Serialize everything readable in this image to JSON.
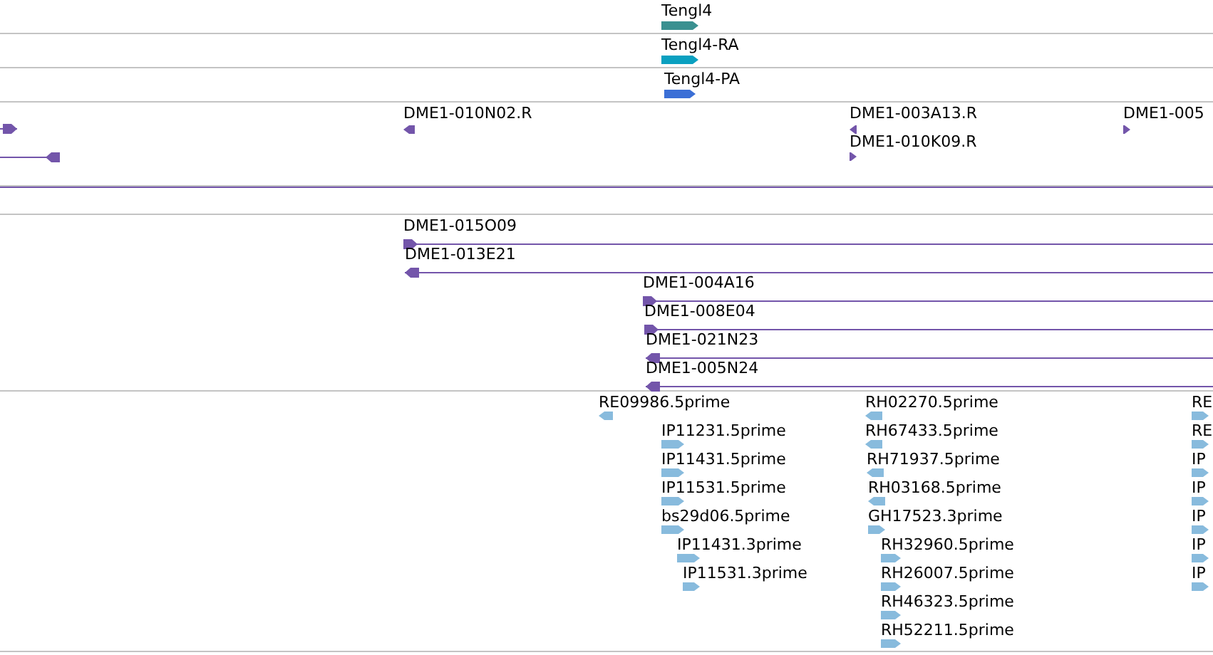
{
  "tracks": [
    {
      "color": "#3a9090",
      "features": [
        {
          "label": "Tengl4",
          "reverse": false
        }
      ]
    },
    {
      "color": "#0aa0c0",
      "features": [
        {
          "label": "Tengl4-RA",
          "reverse": false
        }
      ]
    },
    {
      "color": "#3b6fd6",
      "features": [
        {
          "label": "Tengl4-PA",
          "reverse": false
        }
      ]
    },
    {
      "color": "#7355aa",
      "features": [
        {
          "reverse": false
        },
        {
          "reverse": true
        },
        {
          "label": "DME1-010N02.R",
          "reverse": true
        },
        {
          "label": "DME1-003A13.R",
          "reverse": true
        },
        {
          "label": "DME1-010K09.R",
          "reverse": false
        },
        {
          "label": "DME1-005",
          "reverse": false
        }
      ]
    },
    {
      "color": "#7355aa"
    },
    {
      "color": "#7355aa",
      "features": [
        {
          "label": "DME1-015O09",
          "reverse": false
        },
        {
          "label": "DME1-013E21",
          "reverse": true
        },
        {
          "label": "DME1-004A16",
          "reverse": false
        },
        {
          "label": "DME1-008E04",
          "reverse": false
        },
        {
          "label": "DME1-021N23",
          "reverse": true
        },
        {
          "label": "DME1-005N24",
          "reverse": true
        }
      ]
    },
    {
      "color": "#88bbdd",
      "features": [
        {
          "label": "RE09986.5prime",
          "reverse": true
        },
        {
          "label": "IP11231.5prime",
          "reverse": false
        },
        {
          "label": "IP11431.5prime",
          "reverse": false
        },
        {
          "label": "IP11531.5prime",
          "reverse": false
        },
        {
          "label": "bs29d06.5prime",
          "reverse": false
        },
        {
          "label": "IP11431.3prime",
          "reverse": false
        },
        {
          "label": "IP11531.3prime",
          "reverse": false
        },
        {
          "label": "RH02270.5prime",
          "reverse": true
        },
        {
          "label": "RH67433.5prime",
          "reverse": true
        },
        {
          "label": "RH71937.5prime",
          "reverse": true
        },
        {
          "label": "RH03168.5prime",
          "reverse": true
        },
        {
          "label": "GH17523.3prime",
          "reverse": false
        },
        {
          "label": "RH32960.5prime",
          "reverse": false
        },
        {
          "label": "RH26007.5prime",
          "reverse": false
        },
        {
          "label": "RH46323.5prime",
          "reverse": false
        },
        {
          "label": "RH52211.5prime",
          "reverse": false
        },
        {
          "label": "RE",
          "reverse": false
        },
        {
          "label": "RE",
          "reverse": false
        },
        {
          "label": "IP",
          "reverse": false
        },
        {
          "label": "IP",
          "reverse": false
        },
        {
          "label": "IP",
          "reverse": false
        },
        {
          "label": "IP",
          "reverse": false
        },
        {
          "label": "IP",
          "reverse": false
        }
      ]
    }
  ]
}
